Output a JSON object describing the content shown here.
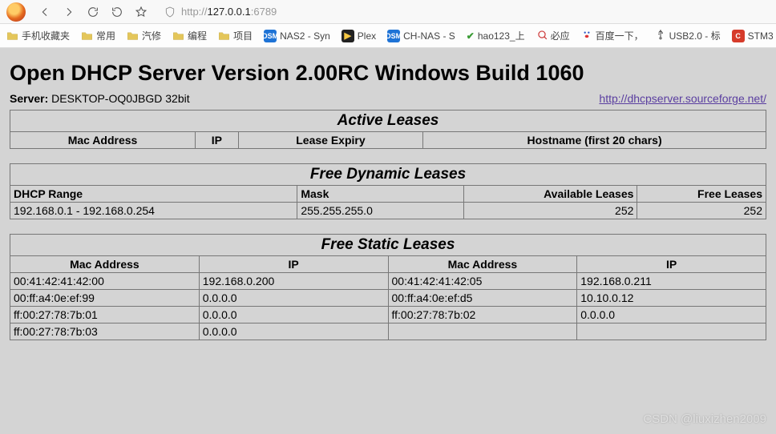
{
  "browser": {
    "url_prefix": "http://",
    "url_host": "127.0.0.1",
    "url_port": ":6789",
    "nav": {
      "back": "‹",
      "fwd": "›"
    }
  },
  "bookmarks": [
    {
      "kind": "folder",
      "label": "手机收藏夹"
    },
    {
      "kind": "folder",
      "label": "常用"
    },
    {
      "kind": "folder",
      "label": "汽修"
    },
    {
      "kind": "folder",
      "label": "编程"
    },
    {
      "kind": "folder",
      "label": "项目"
    },
    {
      "kind": "dsm",
      "label": "NAS2 - Syn"
    },
    {
      "kind": "plex",
      "label": "Plex"
    },
    {
      "kind": "dsm",
      "label": "CH-NAS - S"
    },
    {
      "kind": "hao",
      "label": "hao123_上"
    },
    {
      "kind": "bing",
      "label": "必应"
    },
    {
      "kind": "baidu",
      "label": "百度一下，"
    },
    {
      "kind": "usb",
      "label": "USB2.0 - 标"
    },
    {
      "kind": "stm",
      "label": "STM3"
    }
  ],
  "page": {
    "title": "Open DHCP Server Version 2.00RC Windows Build 1060",
    "server_label": "Server:",
    "server_value": "DESKTOP-OQ0JBGD 32bit",
    "project_link": "http://dhcpserver.sourceforge.net/",
    "watermark": "CSDN @liuxizhen2009"
  },
  "active_leases": {
    "section": "Active Leases",
    "headers": [
      "Mac Address",
      "IP",
      "Lease Expiry",
      "Hostname (first 20 chars)"
    ],
    "rows": []
  },
  "free_dynamic": {
    "section": "Free Dynamic Leases",
    "headers": [
      "DHCP Range",
      "Mask",
      "Available Leases",
      "Free Leases"
    ],
    "rows": [
      {
        "range": "192.168.0.1 - 192.168.0.254",
        "mask": "255.255.255.0",
        "available": "252",
        "free": "252"
      }
    ]
  },
  "free_static": {
    "section": "Free Static Leases",
    "headers": [
      "Mac Address",
      "IP",
      "Mac Address",
      "IP"
    ],
    "rows": [
      {
        "mac1": "00:41:42:41:42:00",
        "ip1": "192.168.0.200",
        "mac2": "00:41:42:41:42:05",
        "ip2": "192.168.0.211"
      },
      {
        "mac1": "00:ff:a4:0e:ef:99",
        "ip1": "0.0.0.0",
        "mac2": "00:ff:a4:0e:ef:d5",
        "ip2": "10.10.0.12"
      },
      {
        "mac1": "ff:00:27:78:7b:01",
        "ip1": "0.0.0.0",
        "mac2": "ff:00:27:78:7b:02",
        "ip2": "0.0.0.0"
      },
      {
        "mac1": "ff:00:27:78:7b:03",
        "ip1": "0.0.0.0",
        "mac2": "",
        "ip2": ""
      }
    ]
  }
}
